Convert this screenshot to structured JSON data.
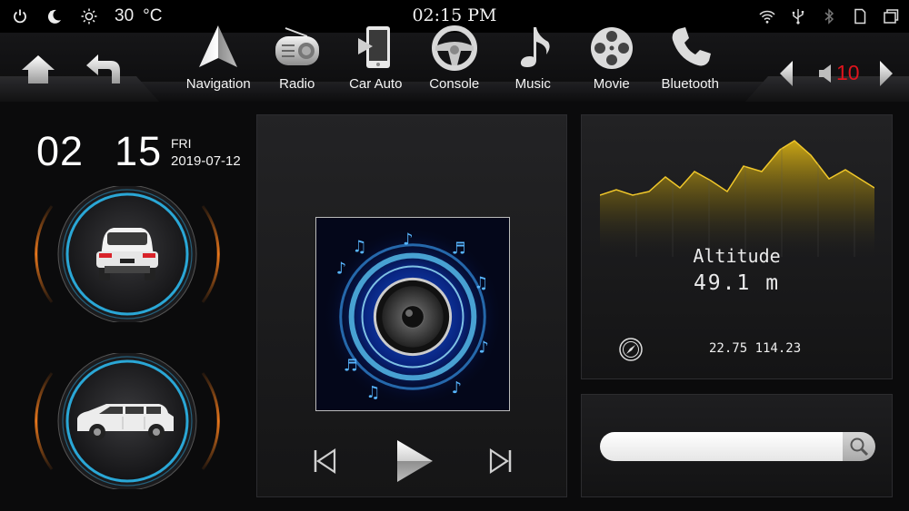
{
  "status_bar": {
    "temperature": "30",
    "temperature_unit": "°C",
    "time": "02:15 PM",
    "icons": [
      "power-icon",
      "moon-icon",
      "brightness-icon",
      "wifi-icon",
      "usb-icon",
      "bluetooth-icon",
      "sim-icon",
      "window-icon"
    ]
  },
  "nav": {
    "apps": [
      {
        "label": "Navigation",
        "icon": "navigation-icon"
      },
      {
        "label": "Radio",
        "icon": "radio-icon"
      },
      {
        "label": "Car Auto",
        "icon": "car-auto-icon"
      },
      {
        "label": "Console",
        "icon": "steering-wheel-icon"
      },
      {
        "label": "Music",
        "icon": "music-note-icon"
      },
      {
        "label": "Movie",
        "icon": "film-reel-icon"
      },
      {
        "label": "Bluetooth",
        "icon": "phone-icon"
      }
    ],
    "volume": "10"
  },
  "clock": {
    "hour": "02",
    "minute": "15",
    "day": "FRI",
    "date": "2019-07-12"
  },
  "altitude": {
    "title": "Altitude",
    "value": "49.1 m",
    "coordinates": "22.75 114.23"
  },
  "search": {
    "placeholder": ""
  },
  "colors": {
    "accent_red": "#e0141d",
    "gauge_blue": "#2aa7d6",
    "gauge_orange": "#e8771c",
    "altitude_gold": "#c9a313"
  }
}
